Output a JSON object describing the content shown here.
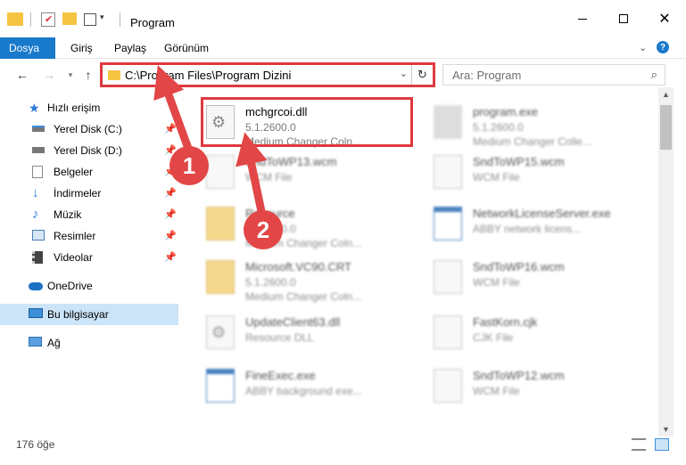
{
  "window": {
    "title": "Program"
  },
  "ribbon": {
    "tabs": [
      "Dosya",
      "Giriş",
      "Paylaş",
      "Görünüm"
    ]
  },
  "address": {
    "path": "C:\\Program Files\\Program Dizini"
  },
  "search": {
    "placeholder": "Ara: Program"
  },
  "sidebar": {
    "quick_access": "Hızlı erişim",
    "items": [
      "Yerel Disk (C:)",
      "Yerel Disk (D:)",
      "Belgeler",
      "İndirmeler",
      "Müzik",
      "Resimler",
      "Videolar"
    ],
    "onedrive": "OneDrive",
    "this_pc": "Bu bilgisayar",
    "network": "Ağ"
  },
  "files": [
    {
      "name": "mchgrcoi.dll",
      "line2": "5.1.2600.0",
      "line3": "Medium Changer Coln...",
      "icon": "dll-gear-icon"
    },
    {
      "name": "program.exe",
      "line2": "5.1.2600.0",
      "line3": "Medium Changer Colle...",
      "icon": "exe-icon"
    },
    {
      "name": "SndToWP13.wcm",
      "line2": "WCM File",
      "line3": "",
      "icon": "file-icon"
    },
    {
      "name": "SndToWP15.wcm",
      "line2": "WCM File",
      "line3": "",
      "icon": "file-icon"
    },
    {
      "name": "Resource",
      "line2": "5.1.2600.0",
      "line3": "Medium Changer Coln...",
      "icon": "folder-icon"
    },
    {
      "name": "NetworkLicenseServer.exe",
      "line2": "ABBY network licens...",
      "line3": "",
      "icon": "exe-icon"
    },
    {
      "name": "Microsoft.VC90.CRT",
      "line2": "5.1.2600.0",
      "line3": "Medium Changer Coln...",
      "icon": "folder-icon"
    },
    {
      "name": "SndToWP16.wcm",
      "line2": "WCM File",
      "line3": "",
      "icon": "file-icon"
    },
    {
      "name": "UpdateClient63.dll",
      "line2": "Resource DLL",
      "line3": "",
      "icon": "dll-gear-icon"
    },
    {
      "name": "FastKorn.cjk",
      "line2": "CJK File",
      "line3": "",
      "icon": "file-icon"
    },
    {
      "name": "FineExec.exe",
      "line2": "ABBY background exe...",
      "line3": "",
      "icon": "exe-icon"
    },
    {
      "name": "SndToWP12.wcm",
      "line2": "WCM File",
      "line3": "",
      "icon": "file-icon"
    }
  ],
  "status": {
    "count": "176 öğe"
  },
  "annotations": {
    "step1": "1",
    "step2": "2"
  },
  "colors": {
    "accent": "#1979ca",
    "highlight": "#e0393e",
    "badge": "#e24646"
  }
}
